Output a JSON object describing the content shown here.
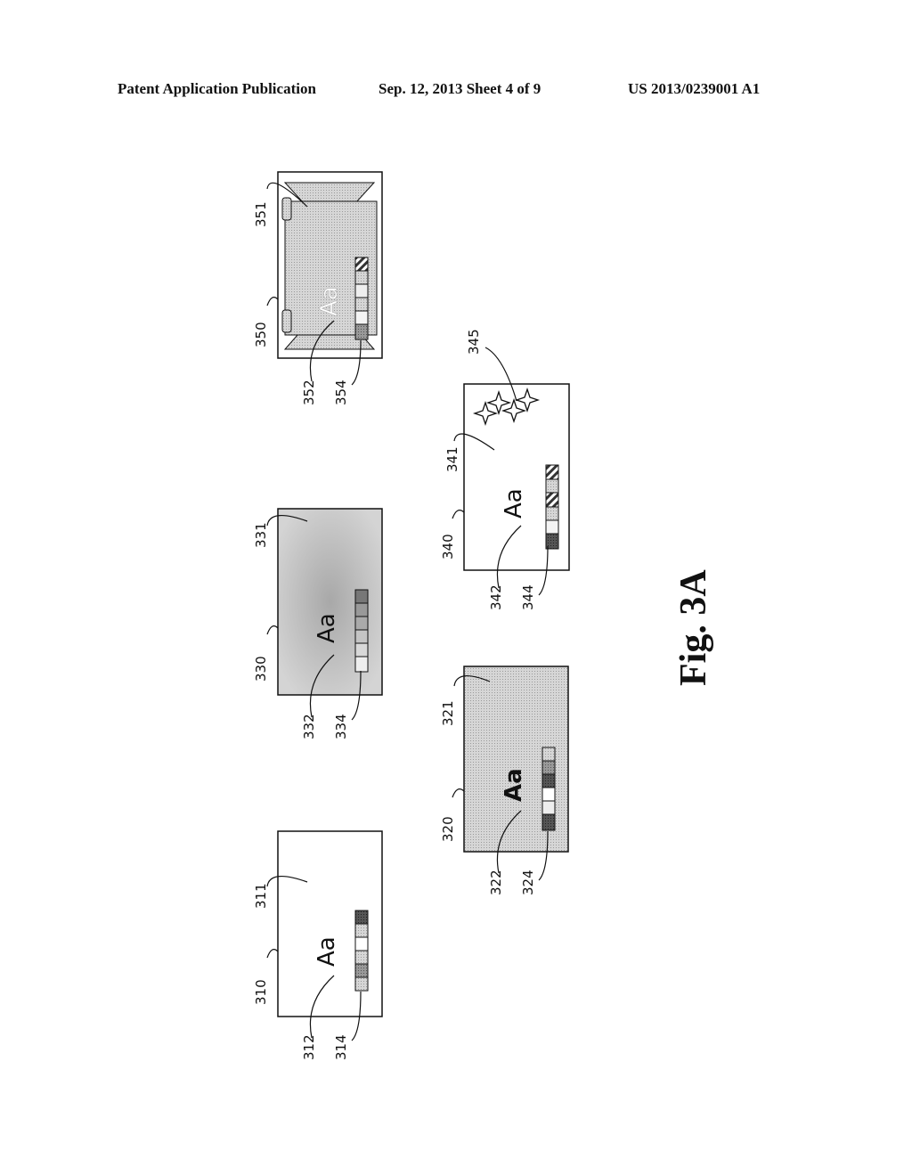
{
  "header": {
    "left": "Patent Application Publication",
    "center": "Sep. 12, 2013   Sheet 4 of 9",
    "right": "US 2013/0239001 A1"
  },
  "figure_label": "Fig. 3A",
  "colors": {
    "line": "#111111",
    "shade": "#cfcfcf",
    "shade_dark": "#c4c4c4"
  },
  "panels": [
    {
      "id": "310",
      "ref": "310",
      "bg_ref": "311",
      "text_ref": "312",
      "palette_ref": "314",
      "sample_text": "Aa",
      "style": "plain"
    },
    {
      "id": "320",
      "ref": "320",
      "bg_ref": "321",
      "text_ref": "322",
      "palette_ref": "324",
      "sample_text": "Aa",
      "style": "bold"
    },
    {
      "id": "330",
      "ref": "330",
      "bg_ref": "331",
      "text_ref": "332",
      "palette_ref": "334",
      "sample_text": "Aa",
      "style": "gradient"
    },
    {
      "id": "340",
      "ref": "340",
      "bg_ref": "341",
      "text_ref": "342",
      "palette_ref": "344",
      "decor_ref": "345",
      "sample_text": "Aa",
      "style": "stars"
    },
    {
      "id": "350",
      "ref": "350",
      "bg_ref": "351",
      "text_ref": "352",
      "palette_ref": "354",
      "sample_text": "Aa",
      "style": "ribbon"
    }
  ]
}
